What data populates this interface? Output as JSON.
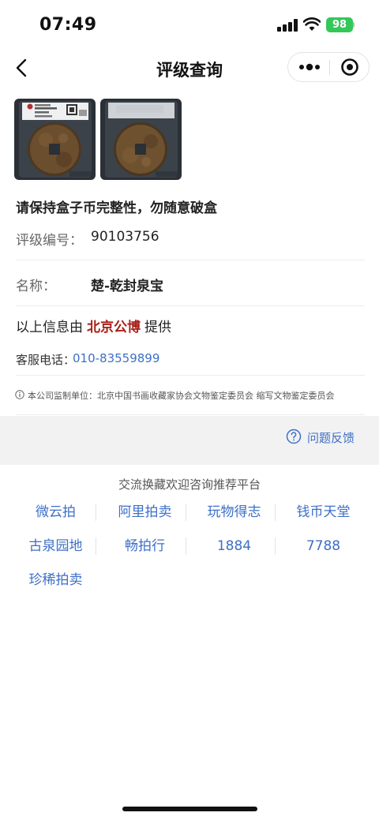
{
  "status_bar": {
    "time": "07:49",
    "battery": "98"
  },
  "nav": {
    "title": "评级查询"
  },
  "notice": "请保持盒子币完整性，勿随意破盒",
  "details": {
    "grade_label": "评级编号：",
    "grade_value": "90103756",
    "name_label": "名称：",
    "name_value": "楚-乾封泉宝"
  },
  "source": {
    "prefix": "以上信息由",
    "org": "北京公博",
    "suffix": "提供"
  },
  "service": {
    "label": "客服电话：",
    "phone": "010-83559899"
  },
  "supervisor_text": "本公司监制单位：北京中国书画收藏家协会文物鉴定委员会 缩写文物鉴定委员会",
  "feedback_label": "问题反馈",
  "platforms": {
    "title": "交流换藏欢迎咨询推荐平台",
    "items": [
      "微云拍",
      "阿里拍卖",
      "玩物得志",
      "钱币天堂",
      "古泉园地",
      "畅拍行",
      "1884",
      "7788",
      "珍稀拍卖"
    ]
  },
  "colors": {
    "link": "#3d6fc7",
    "org": "#a8201a",
    "battery": "#34c759"
  }
}
